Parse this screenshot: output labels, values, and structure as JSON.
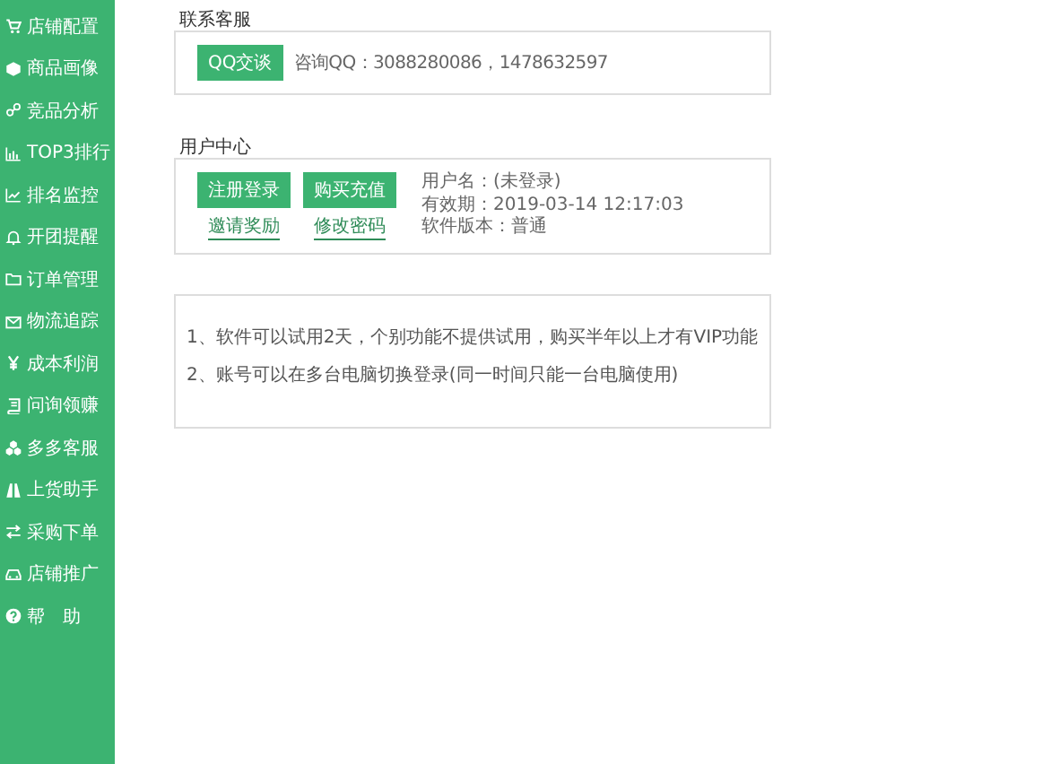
{
  "sidebar": {
    "items": [
      {
        "label": "店铺配置"
      },
      {
        "label": "商品画像"
      },
      {
        "label": "竞品分析"
      },
      {
        "label": "TOP3排行"
      },
      {
        "label": "排名监控"
      },
      {
        "label": "开团提醒"
      },
      {
        "label": "订单管理"
      },
      {
        "label": "物流追踪"
      },
      {
        "label": "成本利润"
      },
      {
        "label": "问询领赚"
      },
      {
        "label": "多多客服"
      },
      {
        "label": "上货助手"
      },
      {
        "label": "采购下单"
      },
      {
        "label": "店铺推广"
      },
      {
        "label": "帮　助"
      }
    ]
  },
  "contact": {
    "title": "联系客服",
    "button": "QQ交谈",
    "text": "咨询QQ：3088280086，1478632597"
  },
  "user_center": {
    "title": "用户中心",
    "buttons": [
      "注册登录",
      "购买充值"
    ],
    "links": [
      "邀请奖励",
      "修改密码"
    ],
    "info": [
      "用户名：(未登录)",
      "有效期：2019-03-14 12:17:03",
      "软件版本：普通"
    ]
  },
  "notes": [
    "1、软件可以试用2天，个别功能不提供试用，购买半年以上才有VIP功能",
    "2、账号可以在多台电脑切换登录(同一时间只能一台电脑使用)"
  ]
}
